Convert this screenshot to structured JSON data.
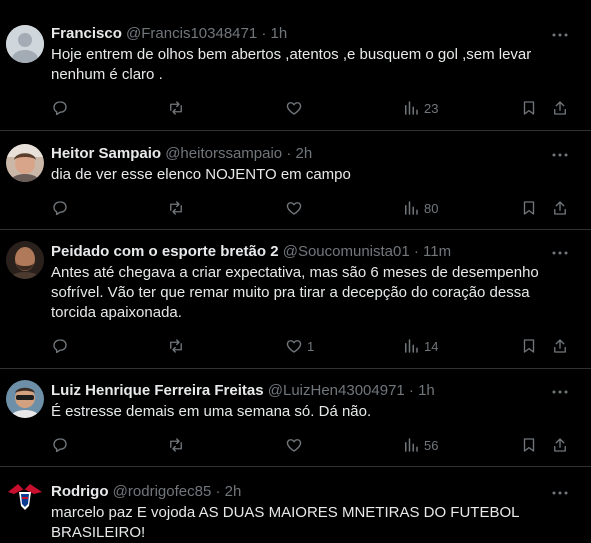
{
  "colors": {
    "background": "#000000",
    "text": "#e7e9ea",
    "muted": "#71767b",
    "divider": "#2f3336"
  },
  "tweets": [
    {
      "name": "Francisco",
      "handle": "@Francis10348471",
      "time": "1h",
      "lines": [
        "Hoje entrem de olhos bem abertos ,atentos ,e busquem o gol ,sem levar",
        "nenhum é claro ."
      ],
      "likes": "",
      "views": "23"
    },
    {
      "name": "Heitor Sampaio",
      "handle": "@heitorssampaio",
      "time": "2h",
      "lines": [
        "dia de ver esse elenco NOJENTO em campo"
      ],
      "likes": "",
      "views": "80"
    },
    {
      "name": "Peidado com o esporte bretão 2",
      "handle": "@Soucomunista01",
      "time": "11m",
      "lines": [
        "Antes até chegava a criar expectativa, mas são 6 meses de desempenho",
        "sofrível. Vão ter que remar muito pra tirar a decepção do coração dessa",
        "torcida apaixonada."
      ],
      "likes": "1",
      "views": "14"
    },
    {
      "name": "Luiz Henrique Ferreira Freitas",
      "handle": "@LuizHen43004971",
      "time": "1h",
      "lines": [
        "É estresse demais em uma semana só. Dá não."
      ],
      "likes": "",
      "views": "56"
    },
    {
      "name": "Rodrigo",
      "handle": "@rodrigofec85",
      "time": "2h",
      "lines": [
        "marcelo paz E vojoda AS DUAS MAIORES MNETIRAS DO FUTEBOL",
        "BRASILEIRO!"
      ]
    }
  ]
}
